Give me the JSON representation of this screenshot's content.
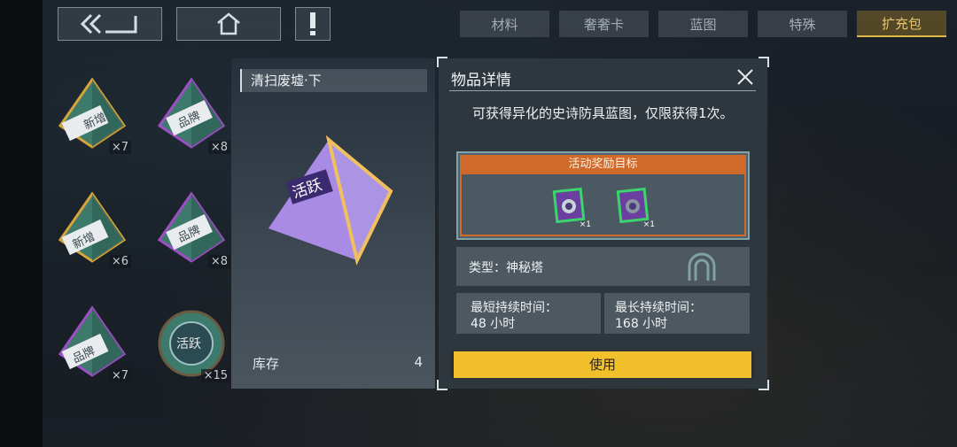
{
  "nav": {
    "back_icon": "double-chevron-back-icon",
    "home_icon": "home-icon",
    "alert_icon": "exclamation-icon"
  },
  "tabs": [
    {
      "label": "材料",
      "active": false
    },
    {
      "label": "奢奢卡",
      "active": false
    },
    {
      "label": "蓝图",
      "active": false
    },
    {
      "label": "特殊",
      "active": false
    },
    {
      "label": "扩充包",
      "active": true
    }
  ],
  "inventory": [
    {
      "badge": "新增",
      "count": "×7",
      "frame": "gold"
    },
    {
      "badge": "品牌",
      "count": "×8",
      "frame": "purple"
    },
    {
      "badge": "新增",
      "count": "×6",
      "frame": "gold"
    },
    {
      "badge": "品牌",
      "count": "×8",
      "frame": "purple"
    },
    {
      "badge": "品牌",
      "count": "×7",
      "frame": "purple"
    },
    {
      "badge": "活跃",
      "count": "×15",
      "frame": "teal"
    }
  ],
  "preview": {
    "title": "清扫废墟·下",
    "badge": "活跃",
    "stock_label": "库存",
    "stock_value": "4"
  },
  "detail": {
    "title": "物品详情",
    "description": "可获得异化的史诗防具蓝图，仅限获得1次。",
    "reward_header": "活动奖励目标",
    "rewards": [
      {
        "count": "×1"
      },
      {
        "count": "×1"
      }
    ],
    "type_text": "类型：神秘塔",
    "min_label": "最短持续时间：",
    "min_value": "48 小时",
    "max_label": "最长持续时间：",
    "max_value": "168 小时",
    "use_button": "使用"
  },
  "colors": {
    "accent_gold": "#f1c02a",
    "reward_orange": "#cf6a2a",
    "tab_active": "#e0b84a"
  }
}
